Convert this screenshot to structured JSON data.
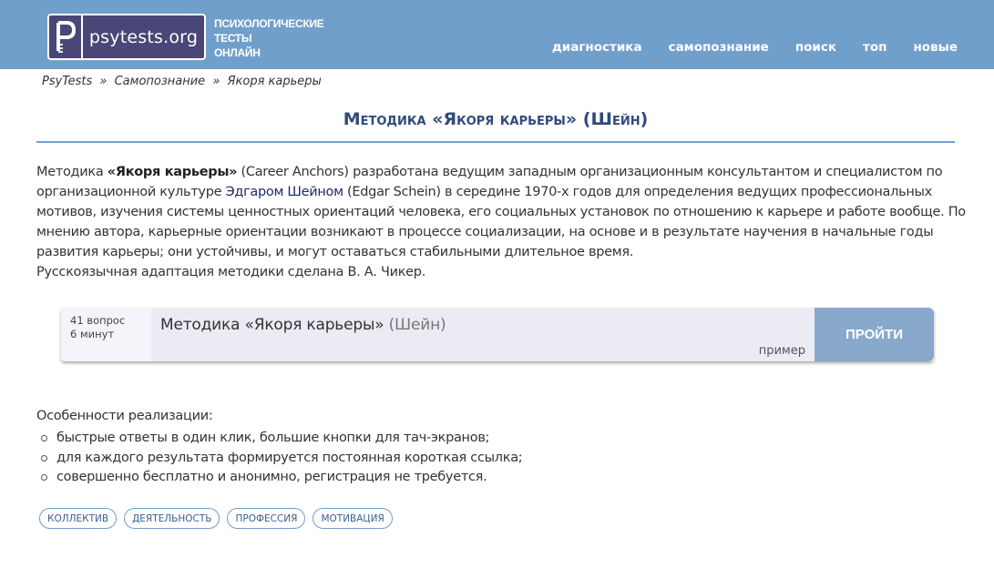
{
  "header": {
    "logo_text": "psytests.org",
    "logo_icon": "key-p-icon",
    "tagline": [
      "ПСИХОЛОГИЧЕСКИЕ",
      "ТЕСТЫ",
      "ОНЛАЙН"
    ],
    "nav": [
      {
        "label": "диагностика"
      },
      {
        "label": "самопознание"
      },
      {
        "label": "поиск"
      },
      {
        "label": "топ"
      },
      {
        "label": "новые"
      }
    ],
    "background": "#719fcb"
  },
  "breadcrumb": {
    "items": [
      "PsyTests",
      "Самопознание",
      "Якоря карьеры"
    ],
    "separator": "»"
  },
  "page": {
    "title": "Методика «Якоря карьеры» (Шейн)",
    "intro": {
      "p1_a": "Методика ",
      "p1_bold": "«Якоря карьеры»",
      "p1_b": " (Career Anchors) разработана ведущим западным организационным консультантом и специалистом по организационной культуре ",
      "p1_link": "Эдгаром Шейном",
      "p1_c": " (Edgar Schein) в середине 1970-х годов для определения ведущих профессиональных мотивов, изучения системы ценностных ориентаций человека, его социальных установок по отношению к карьере и работе вообще. По мнению автора, карьерные ориентации возникают в процессе социализации, на основе и в результате научения в начальные годы развития карьеры; они устойчивы, и могут оставаться стабильными длительное время."
    },
    "adaptation": "Русскоязычная адаптация методики сделана В. А. Чикер."
  },
  "test_card": {
    "questions": "41 вопрос",
    "duration": "6 минут",
    "title": "Методика «Якоря карьеры»",
    "author": "(Шейн)",
    "sample_label": "пример",
    "start_button": "ПРОЙТИ"
  },
  "features": {
    "title": "Особенности реализации:",
    "items": [
      "быстрые ответы в один клик, большие кнопки для тач-экранов;",
      "для каждого результата формируется постоянная короткая ссылка;",
      "совершенно бесплатно и анонимно, регистрация не требуется."
    ]
  },
  "tags": [
    "коллектив",
    "деятельность",
    "профессия",
    "мотивация"
  ]
}
